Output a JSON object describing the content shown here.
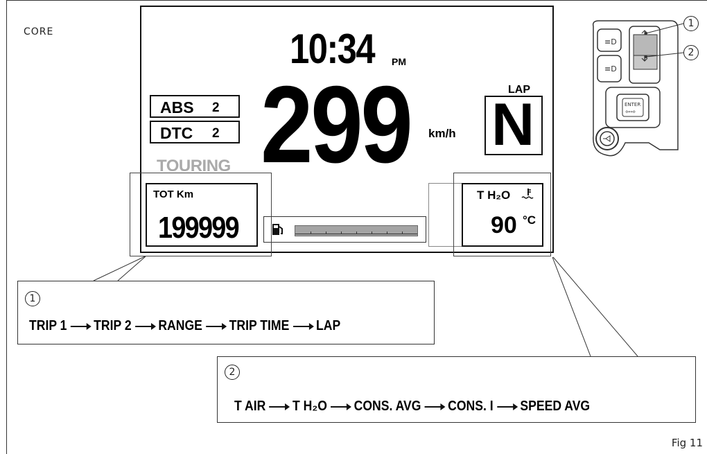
{
  "corner_label": "CORE",
  "figure_label": "Fig 11",
  "dash": {
    "clock": "10:34",
    "clock_suffix": "PM",
    "abs_label": "ABS",
    "abs_value": "2",
    "dtc_label": "DTC",
    "dtc_value": "2",
    "riding_mode": "TOURING",
    "speed": "299",
    "speed_unit": "km/h",
    "lap_label": "LAP",
    "gear": "N",
    "left_panel_title": "TOT Km",
    "left_panel_value": "199999",
    "right_panel_title": "T H₂O",
    "right_panel_value": "90",
    "right_panel_unit": "°C"
  },
  "controller": {
    "callout_1": "1",
    "callout_2": "2",
    "enter_label": "ENTER"
  },
  "sequence_1": {
    "number": "1",
    "items": [
      "TRIP 1",
      "TRIP 2",
      "RANGE",
      "TRIP TIME",
      "LAP"
    ]
  },
  "sequence_2": {
    "number": "2",
    "items": [
      "T AIR",
      "T H₂O",
      "CONS. AVG",
      "CONS. I",
      "SPEED AVG"
    ]
  }
}
